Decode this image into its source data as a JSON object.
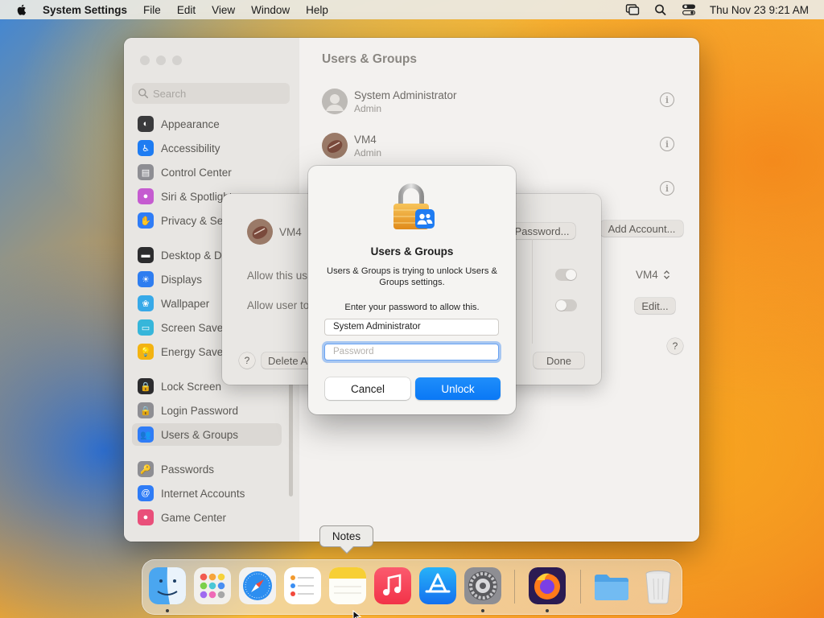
{
  "menubar": {
    "app_name": "System Settings",
    "menus": [
      "File",
      "Edit",
      "View",
      "Window",
      "Help"
    ],
    "clock": "Thu Nov 23  9:21 AM"
  },
  "settings": {
    "title": "Users & Groups",
    "search_placeholder": "Search",
    "sidebar": [
      {
        "label": "Appearance",
        "icon": "appearance-icon",
        "color": "#3a3a3c"
      },
      {
        "label": "Accessibility",
        "icon": "accessibility-icon",
        "color": "#1e7cf2"
      },
      {
        "label": "Control Center",
        "icon": "control-center-icon",
        "color": "#8e8e93"
      },
      {
        "label": "Siri & Spotlight",
        "icon": "siri-icon",
        "color": "#c55bd0"
      },
      {
        "label": "Privacy & Security",
        "icon": "privacy-hand-icon",
        "color": "#2f7cf6"
      },
      {
        "label": "Desktop & Dock",
        "icon": "desktop-dock-icon",
        "color": "#2c2c2e"
      },
      {
        "label": "Displays",
        "icon": "displays-icon",
        "color": "#2e7df0"
      },
      {
        "label": "Wallpaper",
        "icon": "wallpaper-icon",
        "color": "#37a9e8"
      },
      {
        "label": "Screen Saver",
        "icon": "screen-saver-icon",
        "color": "#36b6da"
      },
      {
        "label": "Energy Saver",
        "icon": "energy-saver-icon",
        "color": "#f3b311"
      },
      {
        "label": "Lock Screen",
        "icon": "lock-screen-icon",
        "color": "#2c2c2e"
      },
      {
        "label": "Login Password",
        "icon": "login-password-icon",
        "color": "#8e8e93"
      },
      {
        "label": "Users & Groups",
        "icon": "users-groups-icon",
        "color": "#2f7cf6",
        "selected": true
      },
      {
        "label": "Passwords",
        "icon": "passwords-key-icon",
        "color": "#8e8e93"
      },
      {
        "label": "Internet Accounts",
        "icon": "internet-accounts-icon",
        "color": "#2f7cf6"
      },
      {
        "label": "Game Center",
        "icon": "game-center-icon",
        "color": "#e94f7a"
      }
    ],
    "users": [
      {
        "name": "System Administrator",
        "role": "Admin"
      },
      {
        "name": "VM4",
        "role": "Admin"
      }
    ],
    "add_account_label": "Add Account...",
    "auto_login_value": "VM4",
    "edit_label": "Edit...",
    "help_label": "?"
  },
  "user_sheet": {
    "user_name": "VM4",
    "change_password_label": "Password...",
    "allow_admin_label": "Allow this us",
    "allow_reset_label": "Allow user to",
    "help_label": "?",
    "delete_label": "Delete A",
    "done_label": "Done"
  },
  "unlock_dialog": {
    "title": "Users & Groups",
    "message": "Users & Groups is trying to unlock Users & Groups settings.",
    "prompt": "Enter your password to allow this.",
    "username_value": "System Administrator",
    "password_placeholder": "Password",
    "cancel_label": "Cancel",
    "unlock_label": "Unlock",
    "accent_color": "#0a7cf6"
  },
  "tooltip": "Notes",
  "dock": [
    {
      "name": "finder",
      "running": true
    },
    {
      "name": "launchpad",
      "running": false
    },
    {
      "name": "safari",
      "running": false
    },
    {
      "name": "reminders",
      "running": false
    },
    {
      "name": "notes",
      "running": false
    },
    {
      "name": "music",
      "running": false
    },
    {
      "name": "app-store",
      "running": false
    },
    {
      "name": "system-settings",
      "running": true
    },
    {
      "name": "firefox",
      "running": true
    },
    {
      "name": "downloads-folder",
      "running": false
    },
    {
      "name": "trash",
      "running": false
    }
  ]
}
